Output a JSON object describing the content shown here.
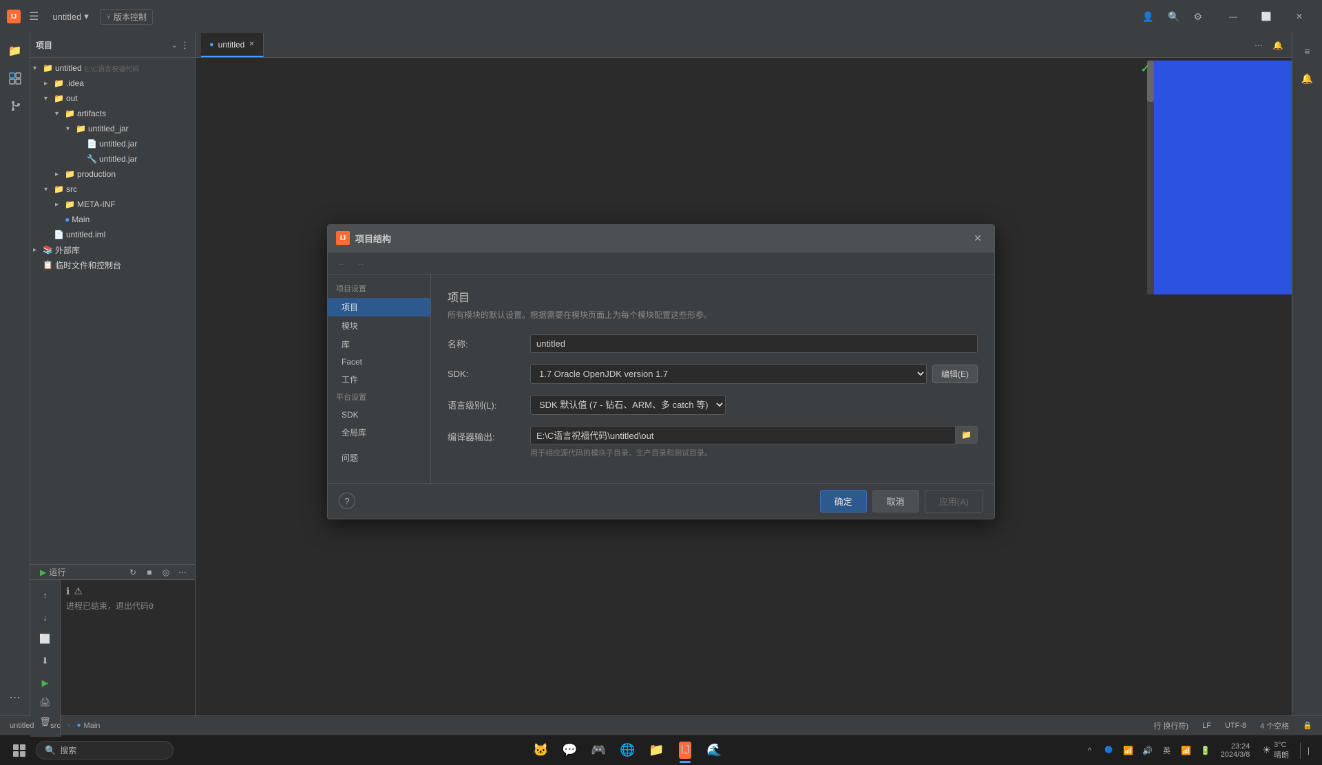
{
  "app": {
    "title": "untitled",
    "logo_text": "IJ",
    "dialog_title": "项目结构",
    "dialog_icon_text": "IJ"
  },
  "titlebar": {
    "menu_icon": "☰",
    "title": "untitled",
    "version_label": "版本控制",
    "back_btn": "‹",
    "forward_btn": "›",
    "close_icon": "✕",
    "minimize_icon": "—",
    "maximize_icon": "⬜",
    "users_icon": "👤",
    "search_icon": "🔍",
    "settings_icon": "⚙"
  },
  "project_panel": {
    "title": "项目",
    "expand_icon": "⌄",
    "nav_back": "←",
    "nav_forward": "→",
    "items": [
      {
        "label": "untitled",
        "sublabel": "E:\\C语言祝福代码",
        "level": 0,
        "icon": "📁",
        "arrow": "▾",
        "type": "root"
      },
      {
        "label": ".idea",
        "level": 1,
        "icon": "📁",
        "arrow": "▸",
        "type": "folder"
      },
      {
        "label": "out",
        "level": 1,
        "icon": "📁",
        "arrow": "▾",
        "type": "folder"
      },
      {
        "label": "artifacts",
        "level": 2,
        "icon": "📁",
        "arrow": "▾",
        "type": "folder"
      },
      {
        "label": "untitled_jar",
        "level": 3,
        "icon": "📁",
        "arrow": "▾",
        "type": "folder"
      },
      {
        "label": "untitled.jar",
        "level": 4,
        "icon": "📄",
        "arrow": "",
        "type": "file"
      },
      {
        "label": "untitled.jar",
        "level": 4,
        "icon": "🔧",
        "arrow": "",
        "type": "file2"
      },
      {
        "label": "production",
        "level": 2,
        "icon": "📁",
        "arrow": "▸",
        "type": "folder"
      },
      {
        "label": "src",
        "level": 1,
        "icon": "📁",
        "arrow": "▾",
        "type": "src"
      },
      {
        "label": "META-INF",
        "level": 2,
        "icon": "📁",
        "arrow": "▸",
        "type": "folder"
      },
      {
        "label": "Main",
        "level": 2,
        "icon": "🔵",
        "arrow": "",
        "type": "class"
      },
      {
        "label": "untitled.iml",
        "level": 1,
        "icon": "📄",
        "arrow": "",
        "type": "file"
      },
      {
        "label": "外部库",
        "level": 0,
        "icon": "📚",
        "arrow": "▸",
        "type": "ext"
      },
      {
        "label": "临时文件和控制台",
        "level": 0,
        "icon": "📋",
        "arrow": "",
        "type": "temp"
      }
    ]
  },
  "run_panel": {
    "title": "运行",
    "toolbar_btns": [
      "↻",
      "■",
      "◎",
      "⋯"
    ]
  },
  "dialog": {
    "title": "项目结构",
    "nav_back_disabled": true,
    "nav_forward_disabled": true,
    "sidebar": {
      "project_settings_label": "项目设置",
      "items_left": [
        {
          "label": "项目",
          "active": true
        },
        {
          "label": "模块"
        },
        {
          "label": "库"
        },
        {
          "label": "Facet"
        },
        {
          "label": "工件"
        }
      ],
      "platform_settings_label": "平台设置",
      "items_right": [
        {
          "label": "SDK"
        },
        {
          "label": "全局库"
        }
      ],
      "problem_label": "问题"
    },
    "content": {
      "section_title": "项目",
      "section_desc": "所有模块的默认设置。根据需要在模块页面上为每个模块配置这些形参。",
      "name_label": "名称:",
      "name_value": "untitled",
      "sdk_label": "SDK:",
      "sdk_value": "1.7 Oracle OpenJDK version 1.7",
      "sdk_edit_btn": "编辑(E)",
      "lang_label": "语言级别(L):",
      "lang_value": "SDK 默认值 (7 - 钻石、ARM、多 catch 等)",
      "compiler_label": "编译器输出:",
      "compiler_value": "E:\\C语言祝福代码\\untitled\\out",
      "compiler_hint": "用于相应源代码的模块子目录、生产目录和测试目录。",
      "browse_icon": "📁"
    },
    "footer": {
      "help_icon": "?",
      "ok_btn": "确定",
      "cancel_btn": "取消",
      "apply_btn": "应用(A)"
    }
  },
  "editor": {
    "tab_label": "untitled",
    "tab_icon": "📄",
    "more_icon": "⋯",
    "notification_icon": "🔔"
  },
  "statusbar": {
    "project_name": "untitled",
    "path_src": "src",
    "path_main": "Main",
    "line_col": "行 换行符)",
    "encoding": "LF",
    "charset": "UTF-8",
    "indent": "4 个空格",
    "lock_icon": "🔒"
  },
  "taskbar": {
    "search_placeholder": "搜索",
    "clock_time": "23:24",
    "clock_date": "2024/3/8",
    "weather_temp": "3°C",
    "weather_desc": "晴朗"
  }
}
